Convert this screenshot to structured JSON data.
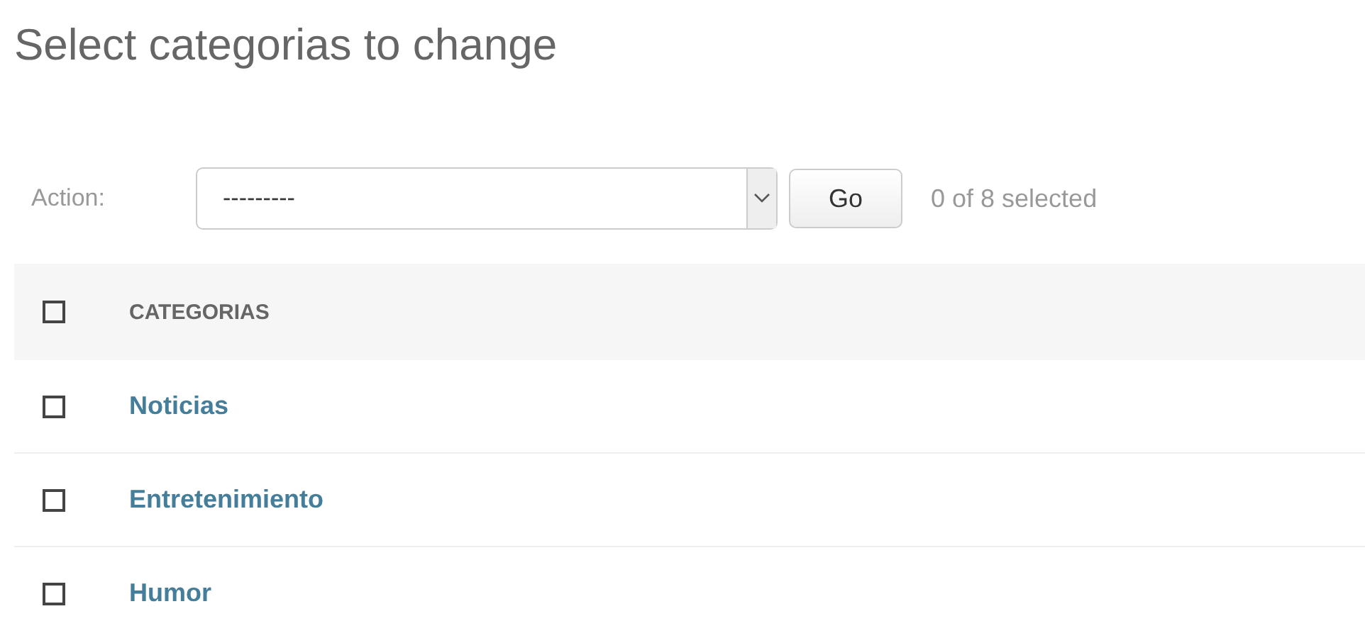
{
  "title": "Select categorias to change",
  "actions": {
    "label": "Action:",
    "value": "---------",
    "go": "Go",
    "counter": "0 of 8 selected"
  },
  "table": {
    "columns": [
      {
        "label": "CATEGORIAS",
        "checked": false
      }
    ],
    "rows": [
      {
        "name": "Noticias",
        "checked": false
      },
      {
        "name": "Entretenimiento",
        "checked": false
      },
      {
        "name": "Humor",
        "checked": false
      }
    ]
  }
}
